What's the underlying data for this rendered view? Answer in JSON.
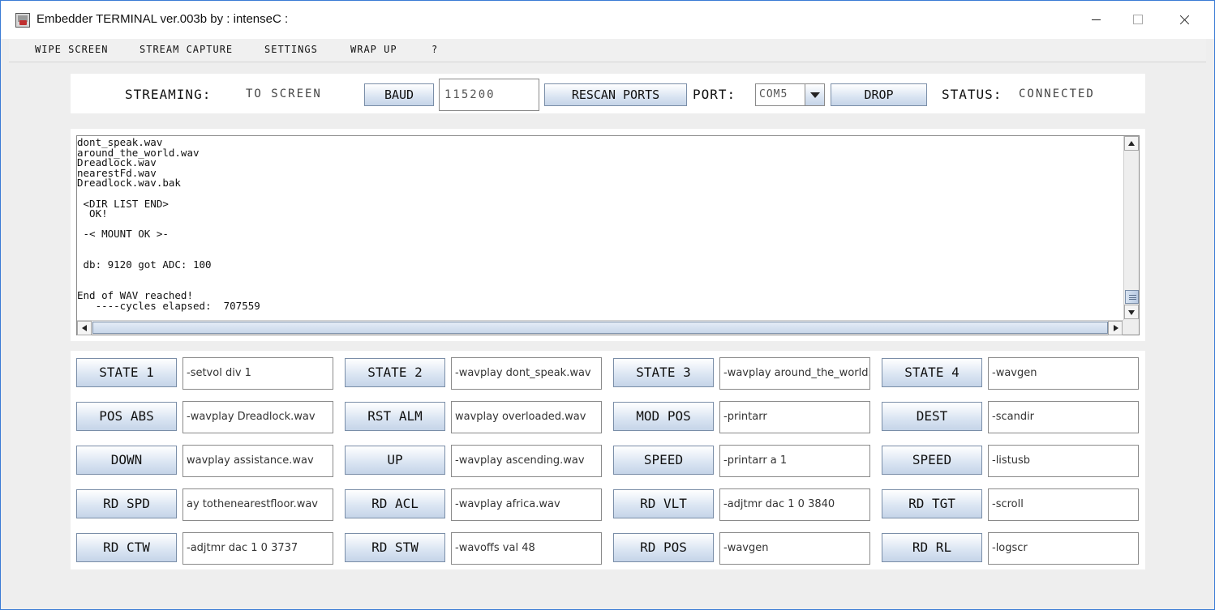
{
  "window": {
    "title": "Embedder TERMINAL ver.003b by : intenseC :"
  },
  "menu": {
    "items": [
      "WIPE SCREEN",
      "STREAM CAPTURE",
      "SETTINGS",
      "WRAP UP",
      "?"
    ]
  },
  "toolbar": {
    "streaming_label": "STREAMING:",
    "streaming_value": "TO SCREEN",
    "baud_button": "BAUD",
    "baud_value": "115200",
    "rescan_button": "RESCAN PORTS",
    "port_label": "PORT:",
    "port_value": "COM5",
    "drop_button": "DROP",
    "status_label": "STATUS:",
    "status_value": "CONNECTED"
  },
  "console": {
    "lines": [
      "dont_speak.wav",
      "around_the_world.wav",
      "Dreadlock.wav",
      "nearestFd.wav",
      "Dreadlock.wav.bak",
      "",
      " <DIR LIST END>",
      "  OK!",
      "",
      " -< MOUNT OK >-",
      "",
      "",
      " db: 9120 got ADC: 100",
      "",
      "",
      "End of WAV reached!",
      "   ----cycles elapsed:  707559"
    ]
  },
  "macros": [
    [
      {
        "label": "STATE 1",
        "cmd": "-setvol div 1"
      },
      {
        "label": "STATE 2",
        "cmd": "-wavplay dont_speak.wav"
      },
      {
        "label": "STATE 3",
        "cmd": "-wavplay around_the_world.wav"
      },
      {
        "label": "STATE 4",
        "cmd": "-wavgen"
      }
    ],
    [
      {
        "label": "POS ABS",
        "cmd": "-wavplay Dreadlock.wav"
      },
      {
        "label": "RST ALM",
        "cmd": "wavplay overloaded.wav"
      },
      {
        "label": "MOD POS",
        "cmd": "-printarr"
      },
      {
        "label": "DEST",
        "cmd": "-scandir"
      }
    ],
    [
      {
        "label": "DOWN",
        "cmd": "wavplay assistance.wav"
      },
      {
        "label": "UP",
        "cmd": "-wavplay ascending.wav"
      },
      {
        "label": "SPEED",
        "cmd": "-printarr a 1"
      },
      {
        "label": "SPEED",
        "cmd": "-listusb"
      }
    ],
    [
      {
        "label": "RD SPD",
        "cmd": "ay tothenearestfloor.wav"
      },
      {
        "label": "RD ACL",
        "cmd": "-wavplay africa.wav"
      },
      {
        "label": "RD VLT",
        "cmd": "-adjtmr dac 1 0 3840"
      },
      {
        "label": "RD TGT",
        "cmd": "-scroll"
      }
    ],
    [
      {
        "label": "RD CTW",
        "cmd": "-adjtmr dac 1 0 3737"
      },
      {
        "label": "RD STW",
        "cmd": "-wavoffs val 48"
      },
      {
        "label": "RD POS",
        "cmd": "-wavgen"
      },
      {
        "label": "RD RL",
        "cmd": "-logscr"
      }
    ]
  ]
}
